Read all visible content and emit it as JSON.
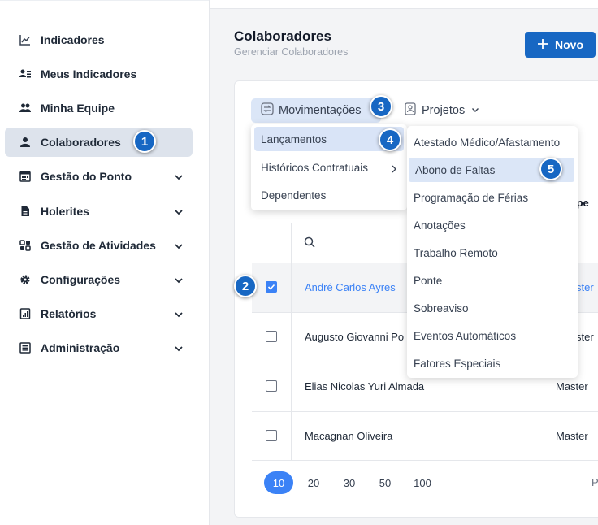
{
  "sidebar": {
    "items": [
      {
        "label": "Indicadores",
        "icon": "chart-line-icon"
      },
      {
        "label": "Meus Indicadores",
        "icon": "user-list-icon"
      },
      {
        "label": "Minha Equipe",
        "icon": "users-icon"
      },
      {
        "label": "Colaboradores",
        "icon": "user-icon"
      },
      {
        "label": "Gestão do Ponto",
        "icon": "calendar-icon"
      },
      {
        "label": "Holerites",
        "icon": "file-icon"
      },
      {
        "label": "Gestão de Atividades",
        "icon": "grid-icon"
      },
      {
        "label": "Configurações",
        "icon": "gear-icon"
      },
      {
        "label": "Relatórios",
        "icon": "report-icon"
      },
      {
        "label": "Administração",
        "icon": "admin-icon"
      }
    ]
  },
  "header": {
    "title": "Colaboradores",
    "subtitle": "Gerenciar Colaboradores",
    "new_button": "Novo"
  },
  "tabs": {
    "movimentacoes": "Movimentações",
    "projetos": "Projetos"
  },
  "menu1": {
    "items": [
      "Lançamentos",
      "Históricos Contratuais",
      "Dependentes"
    ]
  },
  "menu2": {
    "items": [
      "Atestado Médico/Afastamento",
      "Abono de Faltas",
      "Programação de Férias",
      "Anotações",
      "Trabalho Remoto",
      "Ponte",
      "Sobreaviso",
      "Eventos Automáticos",
      "Fatores Especiais"
    ]
  },
  "table": {
    "team_header_partial": "ipe",
    "rows": [
      {
        "name": "André Carlos Ayres",
        "team": "ster",
        "selected": true
      },
      {
        "name": "Augusto Giovanni Po",
        "team": "ster",
        "selected": false
      },
      {
        "name": "Elias Nicolas Yuri Almada",
        "team": "Master",
        "selected": false
      },
      {
        "name": "Macagnan Oliveira",
        "team": "Master",
        "selected": false
      }
    ]
  },
  "pagination": {
    "sizes": [
      "10",
      "20",
      "30",
      "50",
      "100"
    ],
    "trailing": "P"
  },
  "badges": [
    "1",
    "2",
    "3",
    "4",
    "5"
  ],
  "colors": {
    "accent": "#1767c3",
    "link": "#3b82f6",
    "active_bg": "#dbe6f7"
  }
}
